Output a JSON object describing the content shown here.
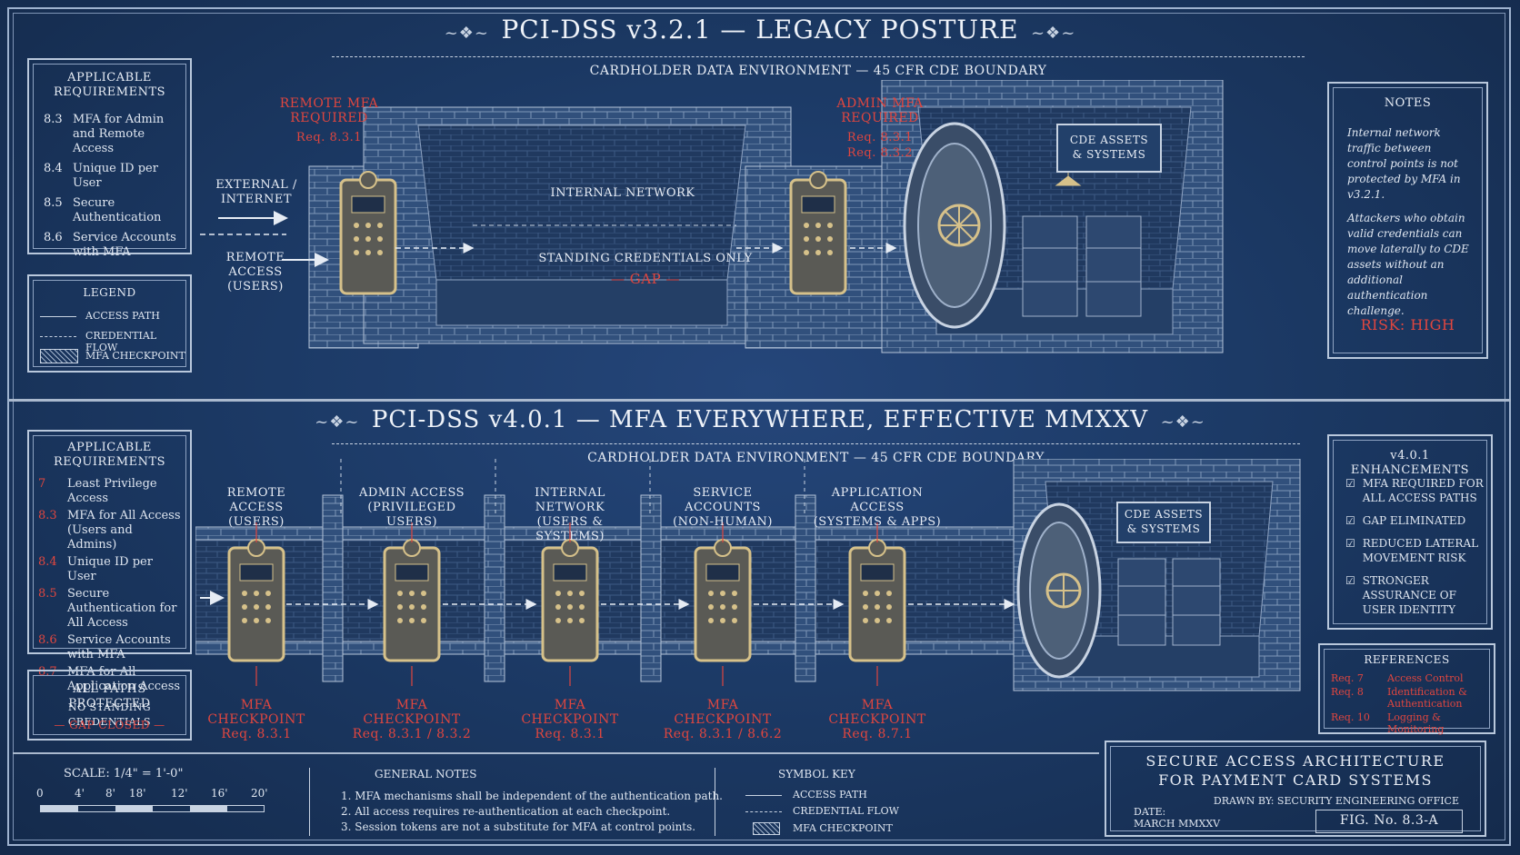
{
  "top": {
    "title": "PCI-DSS v3.2.1 — LEGACY POSTURE",
    "boundary": "CARDHOLDER DATA ENVIRONMENT — 45 CFR CDE BOUNDARY",
    "req_box": {
      "title": "APPLICABLE REQUIREMENTS",
      "items": [
        {
          "num": "8.3",
          "text": "MFA for Admin and Remote Access"
        },
        {
          "num": "8.4",
          "text": "Unique ID per User"
        },
        {
          "num": "8.5",
          "text": "Secure Authentication"
        },
        {
          "num": "8.6",
          "text": "Service Accounts with MFA"
        }
      ]
    },
    "legend": {
      "title": "LEGEND",
      "access": "ACCESS PATH",
      "credential": "CREDENTIAL FLOW",
      "checkpoint": "MFA CHECKPOINT"
    },
    "labels": {
      "external": "EXTERNAL / INTERNET",
      "remote": "REMOTE ACCESS (USERS)",
      "remote_mfa": "REMOTE MFA REQUIRED",
      "remote_req": "Req. 8.3.1",
      "admin_mfa": "ADMIN MFA REQUIRED",
      "admin_req1": "Req. 8.3.1",
      "admin_req2": "Req. 8.3.2",
      "internal": "INTERNAL NETWORK",
      "standing": "STANDING CREDENTIALS ONLY",
      "gap": "— GAP —",
      "cde": "CDE ASSETS & SYSTEMS"
    },
    "notes": {
      "title": "NOTES",
      "p1": "Internal network traffic between control points is not protected by MFA in v3.2.1.",
      "p2": "Attackers who obtain valid credentials can move laterally to CDE assets without an additional authentication challenge.",
      "risk": "RISK: HIGH"
    }
  },
  "bottom": {
    "title": "PCI-DSS v4.0.1 — MFA EVERYWHERE, EFFECTIVE MMXXV",
    "boundary": "CARDHOLDER DATA ENVIRONMENT — 45 CFR CDE BOUNDARY",
    "req_box": {
      "title": "APPLICABLE REQUIREMENTS",
      "items": [
        {
          "num": "7",
          "text": "Least Privilege Access"
        },
        {
          "num": "8.3",
          "text": "MFA for All Access (Users and Admins)"
        },
        {
          "num": "8.4",
          "text": "Unique ID per User"
        },
        {
          "num": "8.5",
          "text": "Secure Authentication for All Access"
        },
        {
          "num": "8.6",
          "text": "Service Accounts with MFA"
        },
        {
          "num": "8.7",
          "text": "MFA for All Application Access"
        }
      ]
    },
    "protected": {
      "l1": "ALL PATHS PROTECTED",
      "l2": "NO STANDING CREDENTIALS",
      "l3": "— GAP CLOSED —"
    },
    "columns": [
      {
        "l1": "REMOTE ACCESS",
        "l2": "(USERS)",
        "cp": "MFA CHECKPOINT",
        "req": "Req. 8.3.1"
      },
      {
        "l1": "ADMIN ACCESS",
        "l2": "(PRIVILEGED USERS)",
        "cp": "MFA CHECKPOINT",
        "req": "Req. 8.3.1 / 8.3.2"
      },
      {
        "l1": "INTERNAL NETWORK",
        "l2": "(USERS & SYSTEMS)",
        "cp": "MFA CHECKPOINT",
        "req": "Req. 8.3.1"
      },
      {
        "l1": "SERVICE ACCOUNTS",
        "l2": "(NON-HUMAN)",
        "cp": "MFA CHECKPOINT",
        "req": "Req. 8.3.1 / 8.6.2"
      },
      {
        "l1": "APPLICATION ACCESS",
        "l2": "(SYSTEMS & APPS)",
        "cp": "MFA CHECKPOINT",
        "req": "Req. 8.7.1"
      }
    ],
    "cde": "CDE ASSETS & SYSTEMS",
    "enhancements": {
      "title": "v4.0.1 ENHANCEMENTS",
      "items": [
        "MFA REQUIRED FOR ALL ACCESS PATHS",
        "GAP ELIMINATED",
        "REDUCED LATERAL MOVEMENT RISK",
        "STRONGER ASSURANCE OF USER IDENTITY"
      ]
    },
    "references": {
      "title": "REFERENCES",
      "items": [
        {
          "req": "Req. 7",
          "text": "Access Control"
        },
        {
          "req": "Req. 8",
          "text": "Identification & Authentication"
        },
        {
          "req": "Req. 10",
          "text": "Logging & Monitoring"
        }
      ]
    }
  },
  "footer": {
    "scale": "SCALE: 1/4\" = 1'-0\"",
    "scale_ticks": [
      "0",
      "4'",
      "8'",
      "18'",
      "12'",
      "16'",
      "20'"
    ],
    "general_title": "GENERAL NOTES",
    "general": [
      "1.  MFA mechanisms shall be independent of the authentication path.",
      "2.  All access requires re-authentication at each checkpoint.",
      "3.  Session tokens are not a substitute for MFA at control points."
    ],
    "symbol_title": "SYMBOL KEY",
    "symbol_access": "ACCESS PATH",
    "symbol_credential": "CREDENTIAL FLOW",
    "symbol_checkpoint": "MFA CHECKPOINT",
    "tb_title1": "SECURE ACCESS ARCHITECTURE",
    "tb_title2": "FOR PAYMENT CARD SYSTEMS",
    "drawn_by": "DRAWN BY:   SECURITY ENGINEERING OFFICE",
    "date_label": "DATE:",
    "date": "MARCH MMXXV",
    "fig": "FIG. No. 8.3-A"
  }
}
